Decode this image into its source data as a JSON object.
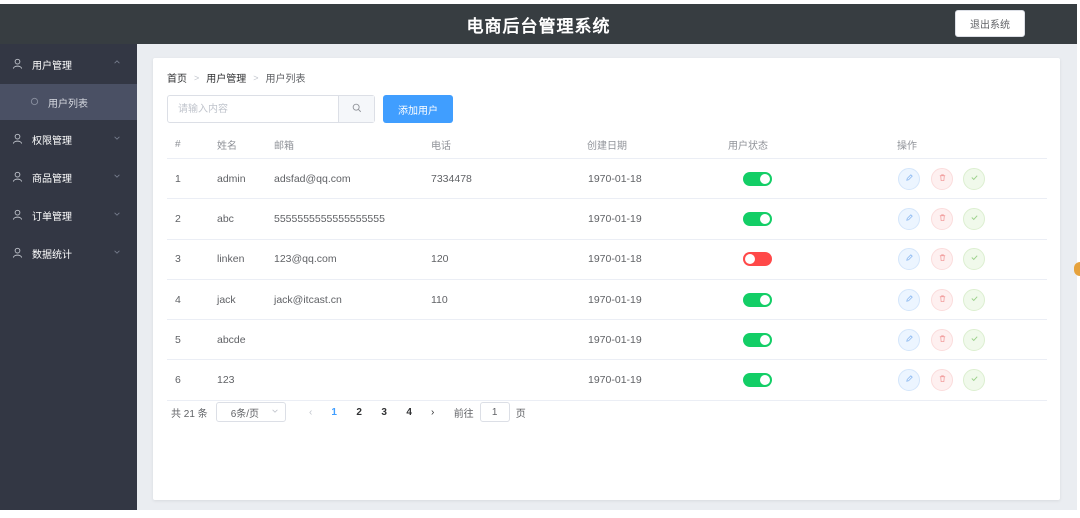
{
  "header": {
    "title": "电商后台管理系统",
    "logout_label": "退出系统"
  },
  "sidebar": {
    "items": [
      {
        "label": "用户管理",
        "open": true,
        "children": [
          {
            "label": "用户列表",
            "active": true
          }
        ]
      },
      {
        "label": "权限管理"
      },
      {
        "label": "商品管理"
      },
      {
        "label": "订单管理"
      },
      {
        "label": "数据统计"
      }
    ]
  },
  "breadcrumb": [
    "首页",
    "用户管理",
    "用户列表"
  ],
  "search": {
    "placeholder": "请输入内容",
    "value": ""
  },
  "toolbar": {
    "add_label": "添加用户"
  },
  "table": {
    "columns": [
      "#",
      "姓名",
      "邮箱",
      "电话",
      "创建日期",
      "用户状态",
      "操作"
    ],
    "rows": [
      {
        "idx": "1",
        "name": "admin",
        "email": "adsfad@qq.com",
        "phone": "7334478",
        "date": "1970-01-18",
        "status": true
      },
      {
        "idx": "2",
        "name": "abc",
        "email": "5555555555555555555",
        "phone": "",
        "date": "1970-01-19",
        "status": true
      },
      {
        "idx": "3",
        "name": "linken",
        "email": "123@qq.com",
        "phone": "120",
        "date": "1970-01-18",
        "status": false
      },
      {
        "idx": "4",
        "name": "jack",
        "email": "jack@itcast.cn",
        "phone": "110",
        "date": "1970-01-19",
        "status": true
      },
      {
        "idx": "5",
        "name": "abcde",
        "email": "",
        "phone": "",
        "date": "1970-01-19",
        "status": true
      },
      {
        "idx": "6",
        "name": "123",
        "email": "",
        "phone": "",
        "date": "1970-01-19",
        "status": true
      }
    ]
  },
  "pagination": {
    "total_label": "共 21 条",
    "page_size_label": "6条/页",
    "pages": [
      "1",
      "2",
      "3",
      "4"
    ],
    "current_page": "1",
    "goto_label": "前往",
    "goto_value": "1",
    "page_unit": "页"
  },
  "colors": {
    "header_bg": "#373d41",
    "sidebar_bg": "#333744",
    "primary": "#409eff",
    "switch_on": "#13ce66",
    "switch_off": "#ff4949"
  },
  "icons": {
    "menu": "user-icon",
    "search": "search-icon",
    "edit": "edit-icon",
    "delete": "delete-icon",
    "assign": "check-icon"
  }
}
